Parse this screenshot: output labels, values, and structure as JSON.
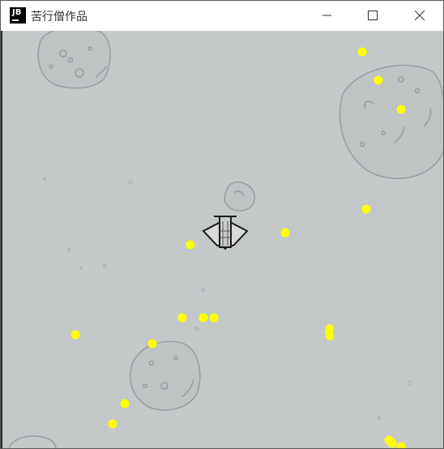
{
  "window": {
    "title": "苦行僧作品",
    "icon": "jetbrains-icon",
    "icon_text": "JB",
    "controls": [
      "minimize-icon",
      "maximize-icon",
      "close-icon"
    ]
  },
  "game": {
    "background_color": "#c4c8c9",
    "bullet_color": "#ffff00",
    "player": "spaceship",
    "asteroid_count": 4,
    "bullet_count": 20
  }
}
